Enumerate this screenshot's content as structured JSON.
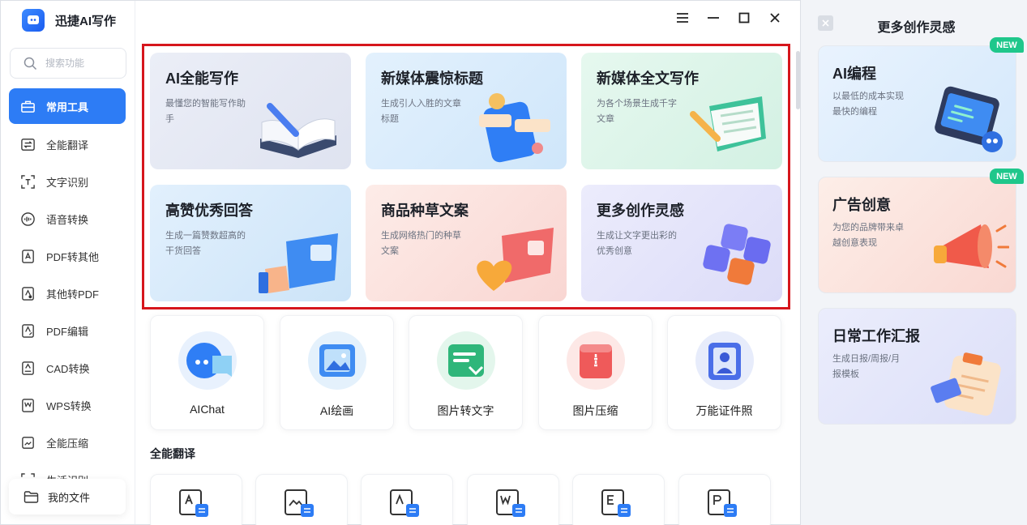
{
  "app": {
    "name": "迅捷AI写作"
  },
  "search": {
    "placeholder": "搜索功能"
  },
  "sidebar": {
    "items": [
      {
        "label": "常用工具",
        "icon": "toolbox-icon"
      },
      {
        "label": "全能翻译",
        "icon": "translate-icon"
      },
      {
        "label": "文字识别",
        "icon": "text-scan-icon"
      },
      {
        "label": "语音转换",
        "icon": "voice-icon"
      },
      {
        "label": "PDF转其他",
        "icon": "pdf-convert-icon"
      },
      {
        "label": "其他转PDF",
        "icon": "to-pdf-icon"
      },
      {
        "label": "PDF编辑",
        "icon": "pdf-edit-icon"
      },
      {
        "label": "CAD转换",
        "icon": "cad-icon"
      },
      {
        "label": "WPS转换",
        "icon": "wps-icon"
      },
      {
        "label": "全能压缩",
        "icon": "compress-icon"
      },
      {
        "label": "生活识别",
        "icon": "life-scan-icon"
      }
    ],
    "my_files": "我的文件"
  },
  "cards": [
    {
      "title": "AI全能写作",
      "desc": "最懂您的智能写作助手",
      "bg": "#e6e8f3"
    },
    {
      "title": "新媒体震惊标题",
      "desc": "生成引人入胜的文章标题",
      "bg": "#dcecfb"
    },
    {
      "title": "新媒体全文写作",
      "desc": "为各个场景生成千字文章",
      "bg": "#dff5ec"
    },
    {
      "title": "高赞优秀回答",
      "desc": "生成一篇赞数超高的干货回答",
      "bg": "#dcedfb"
    },
    {
      "title": "商品种草文案",
      "desc": "生成网络热门的种草文案",
      "bg": "#fbe6e4"
    },
    {
      "title": "更多创作灵感",
      "desc": "生成让文字更出彩的优秀创意",
      "bg": "#e6e6fa"
    }
  ],
  "tools": [
    {
      "label": "AIChat",
      "icon": "chat-bubble-icon"
    },
    {
      "label": "AI绘画",
      "icon": "picture-icon"
    },
    {
      "label": "图片转文字",
      "icon": "image-to-text-icon"
    },
    {
      "label": "图片压缩",
      "icon": "zip-icon"
    },
    {
      "label": "万能证件照",
      "icon": "id-photo-icon"
    }
  ],
  "translate_section": {
    "title": "全能翻译",
    "tiles": [
      "doc-translate-icon",
      "image-translate-icon",
      "text-translate-icon",
      "word-translate-icon",
      "excel-translate-icon",
      "ppt-translate-icon"
    ]
  },
  "right_panel": {
    "title": "更多创作灵感",
    "cards": [
      {
        "title": "AI编程",
        "desc": "以最低的成本实现最快的编程",
        "badge": "NEW"
      },
      {
        "title": "广告创意",
        "desc": "为您的品牌带来卓越创意表现",
        "badge": "NEW"
      },
      {
        "title": "日常工作汇报",
        "desc": "生成日报/周报/月报模板",
        "badge": ""
      }
    ]
  },
  "colors": {
    "accent": "#2d7cf5",
    "highlight": "#d6161c",
    "badge": "#1fc78b"
  }
}
